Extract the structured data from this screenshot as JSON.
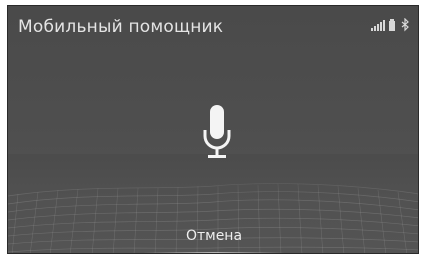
{
  "header": {
    "title": "Мобильный помощник",
    "status_icons": [
      "signal-strength-icon",
      "battery-icon",
      "bluetooth-icon"
    ]
  },
  "main": {
    "icon": "microphone-icon"
  },
  "footer": {
    "cancel_label": "Отмена"
  },
  "colors": {
    "background": "#4c4c4c",
    "text": "#e4e4e4"
  }
}
